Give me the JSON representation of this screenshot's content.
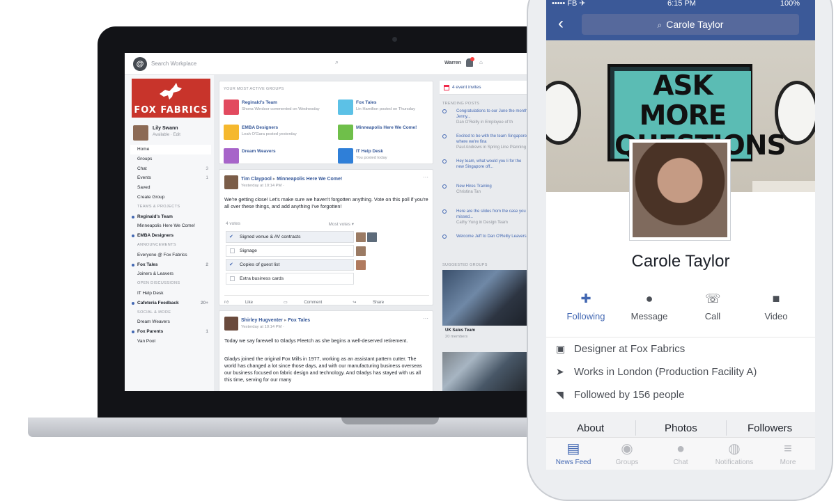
{
  "workplace": {
    "search_placeholder": "Search Workplace",
    "me_label": "Warren",
    "brand": "FOX FABRICS",
    "user": {
      "name": "Lily Swann",
      "status": "Available · Edit"
    },
    "nav": [
      {
        "label": "Home",
        "count": "",
        "type": "item",
        "selected": true
      },
      {
        "label": "Groups",
        "count": "",
        "type": "item"
      },
      {
        "label": "Chat",
        "count": "3",
        "type": "item"
      },
      {
        "label": "Events",
        "count": "1",
        "type": "item"
      },
      {
        "label": "Saved",
        "count": "",
        "type": "item"
      },
      {
        "label": "Create Group",
        "count": "",
        "type": "item"
      },
      {
        "label": "TEAMS & PROJECTS",
        "count": "",
        "type": "head"
      },
      {
        "label": "Reginald's Team",
        "count": "",
        "type": "bold"
      },
      {
        "label": "Minneapolis Here We Come!",
        "count": "",
        "type": "item"
      },
      {
        "label": "EMBA Designers",
        "count": "",
        "type": "bold"
      },
      {
        "label": "ANNOUNCEMENTS",
        "count": "",
        "type": "head"
      },
      {
        "label": "Everyone @ Fox Fabrics",
        "count": "",
        "type": "item"
      },
      {
        "label": "Fox Tales",
        "count": "2",
        "type": "bold"
      },
      {
        "label": "Joiners & Leavers",
        "count": "",
        "type": "item"
      },
      {
        "label": "OPEN DISCUSSIONS",
        "count": "",
        "type": "head"
      },
      {
        "label": "IT Help Desk",
        "count": "",
        "type": "item"
      },
      {
        "label": "Cafeteria Feedback",
        "count": "20+",
        "type": "bold"
      },
      {
        "label": "SOCIAL & MORE",
        "count": "",
        "type": "head"
      },
      {
        "label": "Dream Weavers",
        "count": "",
        "type": "item"
      },
      {
        "label": "Fox Parents",
        "count": "1",
        "type": "bold"
      },
      {
        "label": "Van Pool",
        "count": "",
        "type": "item"
      }
    ],
    "groups_title": "YOUR MOST ACTIVE GROUPS",
    "groups": [
      {
        "name": "Reginald's Team",
        "sub": "Shona Windsor commented on Wednesday",
        "color": "#e24a5f"
      },
      {
        "name": "Fox Tales",
        "sub": "Lin Hamilton posted on Thursday",
        "color": "#5cc1e6"
      },
      {
        "name": "EMBA Designers",
        "sub": "Leah O'Gara posted yesterday",
        "color": "#f5b82e"
      },
      {
        "name": "Minneapolis Here We Come!",
        "sub": "",
        "color": "#6fbf4a"
      },
      {
        "name": "Dream Weavers",
        "sub": "",
        "color": "#a764c9"
      },
      {
        "name": "IT Help Desk",
        "sub": "You posted today",
        "color": "#2f7fd8"
      }
    ],
    "post1": {
      "author": "Tim Claypool",
      "target": "Minneapolis Here We Come!",
      "time": "Yesterday at 10:14 PM · ",
      "text": "We're getting close! Let's make sure we haven't forgotten anything. Vote on this poll if you're all over these things, and add anything I've forgotten!",
      "votes": "4 votes",
      "sort": "Most votes ▾",
      "options": [
        {
          "label": "Signed venue & AV contracts",
          "voted": true
        },
        {
          "label": "Signage",
          "voted": false
        },
        {
          "label": "Copies of guest list",
          "voted": true
        },
        {
          "label": "Extra business cards",
          "voted": false
        }
      ],
      "actions": [
        "Like",
        "Comment",
        "Share"
      ]
    },
    "post2": {
      "author": "Shirley Hugventer",
      "target": "Fox Tales",
      "time": "Yesterday at 10:14 PM · ",
      "text1": "Today we say farewell to Gladys Fleetch as she begins a well-deserved retirement.",
      "text2": "Gladys joined the original Fox Mills in 1977, working as an assistant pattern cutter. The world has changed a lot since those days, and with our manufacturing business overseas our business focused on fabric design and technology. And Gladys has stayed with us all this time, serving for our many"
    },
    "events_label": "4 event invites",
    "trending_title": "TRENDING POSTS",
    "trending": [
      {
        "text": "Congratulations to our June the month, Jenny...",
        "sub": "Dan O'Reilly in Employee of th"
      },
      {
        "text": "Excited to be with the team Singapore, where we're fina",
        "sub": "Paul Andrews in Spring Line Planning"
      },
      {
        "text": "Hey team, what would you li for the new Singapore off...",
        "sub": ""
      },
      {
        "text": "New Hires Training",
        "sub": "Christina Tan"
      },
      {
        "text": "Here are the slides from the case you missed...",
        "sub": "Cathy Yung in Design Team"
      },
      {
        "text": "Welcome Jeff to Dan O'Reilly Leavers",
        "sub": ""
      }
    ],
    "suggested_title": "SUGGESTED GROUPS",
    "suggested_name": "UK Sales Team",
    "suggested_members": "20 members"
  },
  "phone": {
    "status_left": "••••• FB ✈",
    "status_time": "6:15 PM",
    "status_right": "100%",
    "search_value": "Carole Taylor",
    "poster_text": "ASK MORE QUESTIONS",
    "name": "Carole Taylor",
    "actions": [
      {
        "label": "Following",
        "icon": "following-icon",
        "active": true
      },
      {
        "label": "Message",
        "icon": "message-icon",
        "active": false
      },
      {
        "label": "Call",
        "icon": "phone-icon",
        "active": false
      },
      {
        "label": "Video",
        "icon": "video-icon",
        "active": false
      }
    ],
    "info": [
      {
        "text": "Designer at Fox Fabrics",
        "icon": "briefcase-icon"
      },
      {
        "text": "Works in London (Production Facility A)",
        "icon": "location-icon"
      },
      {
        "text": "Followed by 156 people",
        "icon": "rss-icon"
      }
    ],
    "tabs": [
      "About",
      "Photos",
      "Followers"
    ],
    "bottom_nav": [
      "News Feed",
      "Groups",
      "Chat",
      "Notifications",
      "More"
    ],
    "accent": "#4267b2",
    "nav_color": "#3b5998"
  }
}
